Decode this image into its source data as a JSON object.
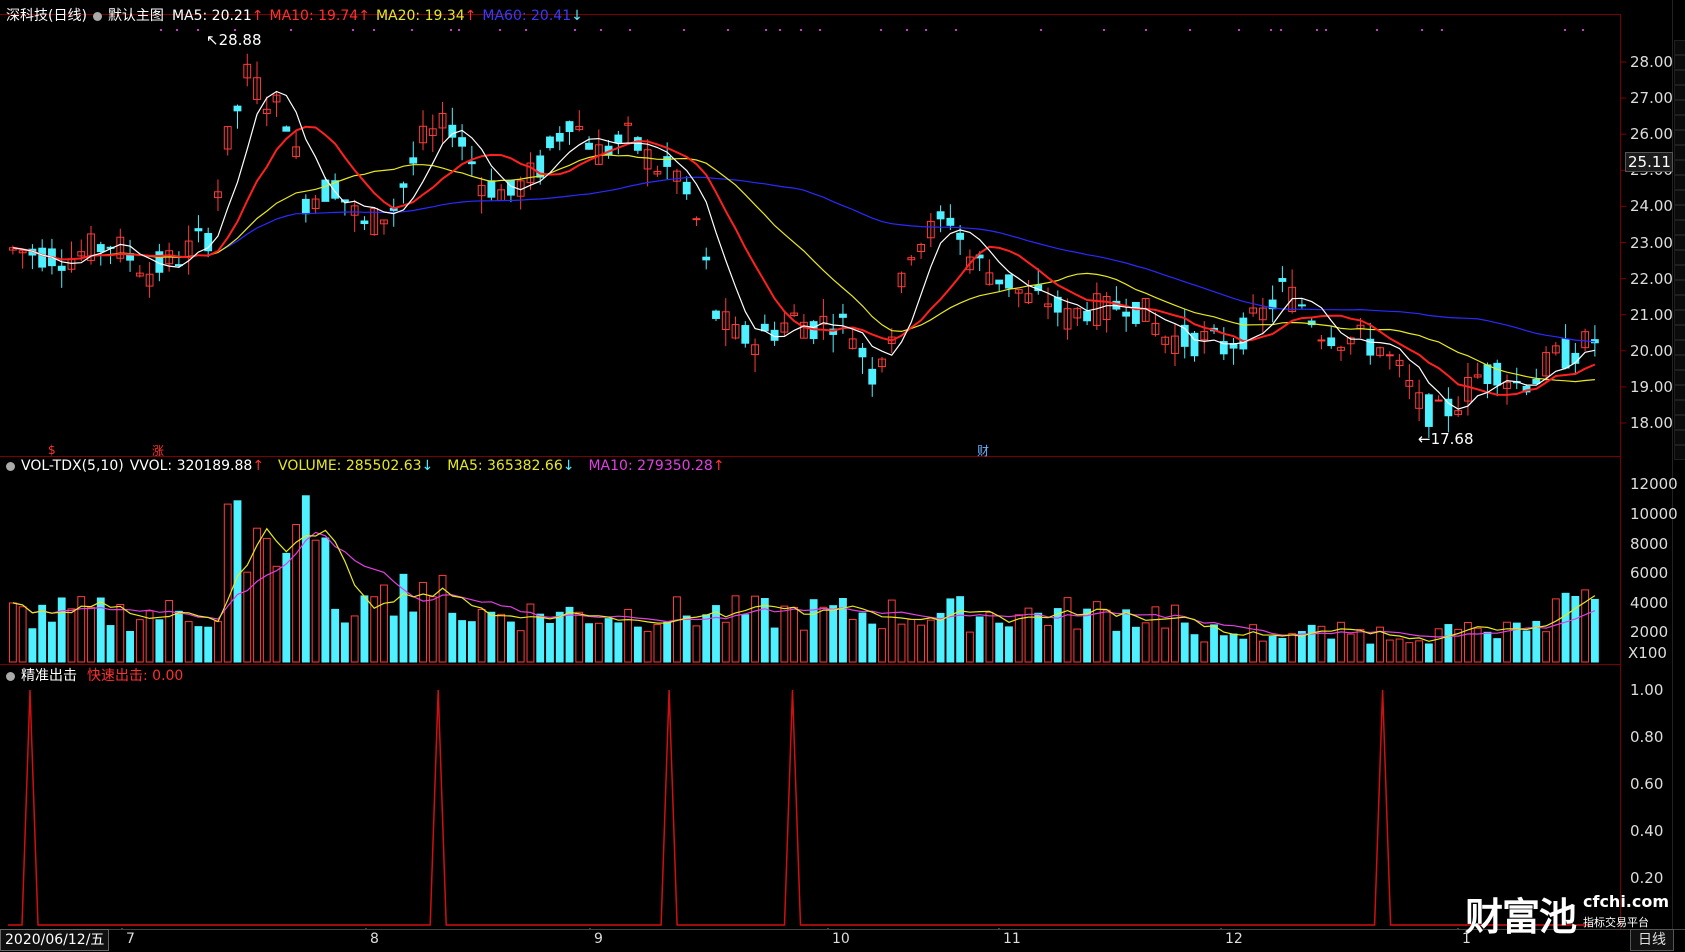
{
  "main": {
    "title": "深科技(日线)",
    "chart_name": "默认主图",
    "ma5": "MA5: 20.21",
    "ma5_arrow": "↑",
    "ma10": "MA10: 19.74",
    "ma10_arrow": "↑",
    "ma20": "MA20: 19.34",
    "ma20_arrow": "↑",
    "ma60": "MA60: 20.41",
    "ma60_arrow": "↓",
    "high_label": "28.88",
    "low_label": "17.68",
    "current_price": "25.11",
    "y_ticks": [
      "28.00",
      "27.00",
      "26.00",
      "25.00",
      "24.00",
      "23.00",
      "22.00",
      "21.00",
      "20.00",
      "19.00",
      "18.00"
    ],
    "markers": [
      {
        "text": "$",
        "color": "#ff3030"
      },
      {
        "text": "涨",
        "color": "#ff3030"
      },
      {
        "text": "财",
        "color": "#6db0ff"
      }
    ]
  },
  "volume": {
    "title": "VOL-TDX(5,10)",
    "vvol": "VVOL: 320189.88",
    "vvol_arrow": "↑",
    "volume": "VOLUME: 285502.63",
    "volume_arrow": "↓",
    "ma5": "MA5: 365382.66",
    "ma5_arrow": "↓",
    "ma10": "MA10: 279350.28",
    "ma10_arrow": "↑",
    "y_ticks": [
      "12000",
      "10000",
      "8000",
      "6000",
      "4000",
      "2000"
    ],
    "unit": "X100"
  },
  "indicator": {
    "title": "精准出击",
    "fast": "快速出击: 0.00",
    "y_ticks": [
      "1.00",
      "0.80",
      "0.60",
      "0.40",
      "0.20"
    ]
  },
  "time_axis": {
    "date": "2020/06/12/五",
    "months": [
      "7",
      "8",
      "9",
      "10",
      "11",
      "12",
      "1"
    ]
  },
  "period_button": "日线",
  "watermark": {
    "brand": "财富池",
    "site": "cfchi.com",
    "tagline": "指标交易平台"
  },
  "colors": {
    "up": "#ff3b3b",
    "down": "#4ff0ff",
    "ma5": "#ffffff",
    "ma10": "#ff2020",
    "ma20": "#e8e820",
    "ma60": "#2a2aff",
    "vol_ma10": "#e040e0",
    "vol_ma5": "#e8e820",
    "signal": "#d01010"
  },
  "chart_data": {
    "type": "line",
    "title": "精准出击",
    "series": [
      {
        "name": "快速出击",
        "x": [
          0.0,
          0.258,
          0.404,
          0.482,
          0.855
        ],
        "values": [
          1.0,
          1.0,
          1.0,
          1.0,
          1.0
        ]
      }
    ],
    "ylim": [
      0,
      1.0
    ]
  }
}
